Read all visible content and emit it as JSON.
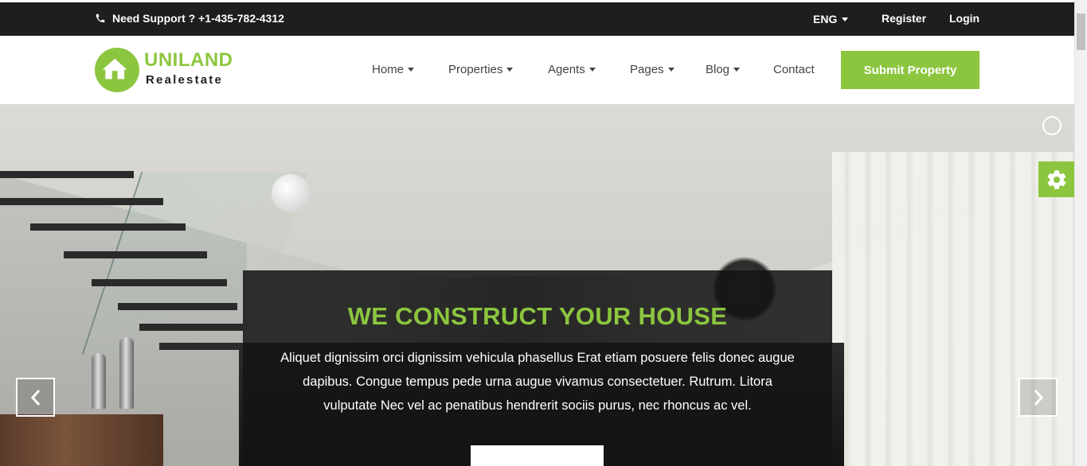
{
  "topbar": {
    "support_text": "Need Support ? +1-435-782-4312",
    "language": "ENG",
    "register_label": "Register",
    "login_label": "Login"
  },
  "logo": {
    "brand": "UNILAND",
    "tagline": "Realestate"
  },
  "nav": {
    "items": [
      {
        "label": "Home",
        "has_dropdown": true
      },
      {
        "label": "Properties",
        "has_dropdown": true
      },
      {
        "label": "Agents",
        "has_dropdown": true
      },
      {
        "label": "Pages",
        "has_dropdown": true
      },
      {
        "label": "Blog",
        "has_dropdown": true
      },
      {
        "label": "Contact",
        "has_dropdown": false
      }
    ],
    "submit_label": "Submit Property"
  },
  "hero": {
    "title": "WE CONSTRUCT YOUR HOUSE",
    "text": "Aliquet dignissim orci dignissim vehicula phasellus Erat etiam posuere felis donec augue dapibus. Congue tempus pede urna augue vivamus consectetuer. Rutrum. Litora vulputate Nec vel ac penatibus hendrerit sociis purus, nec rhoncus ac vel."
  },
  "icons": {
    "phone": "phone-icon",
    "prev": "chevron-left-icon",
    "next": "chevron-right-icon",
    "settings": "gear-icon"
  },
  "colors": {
    "accent": "#8cc63f",
    "topbar_bg": "#1e1e1e",
    "caption_bg": "#141414"
  }
}
